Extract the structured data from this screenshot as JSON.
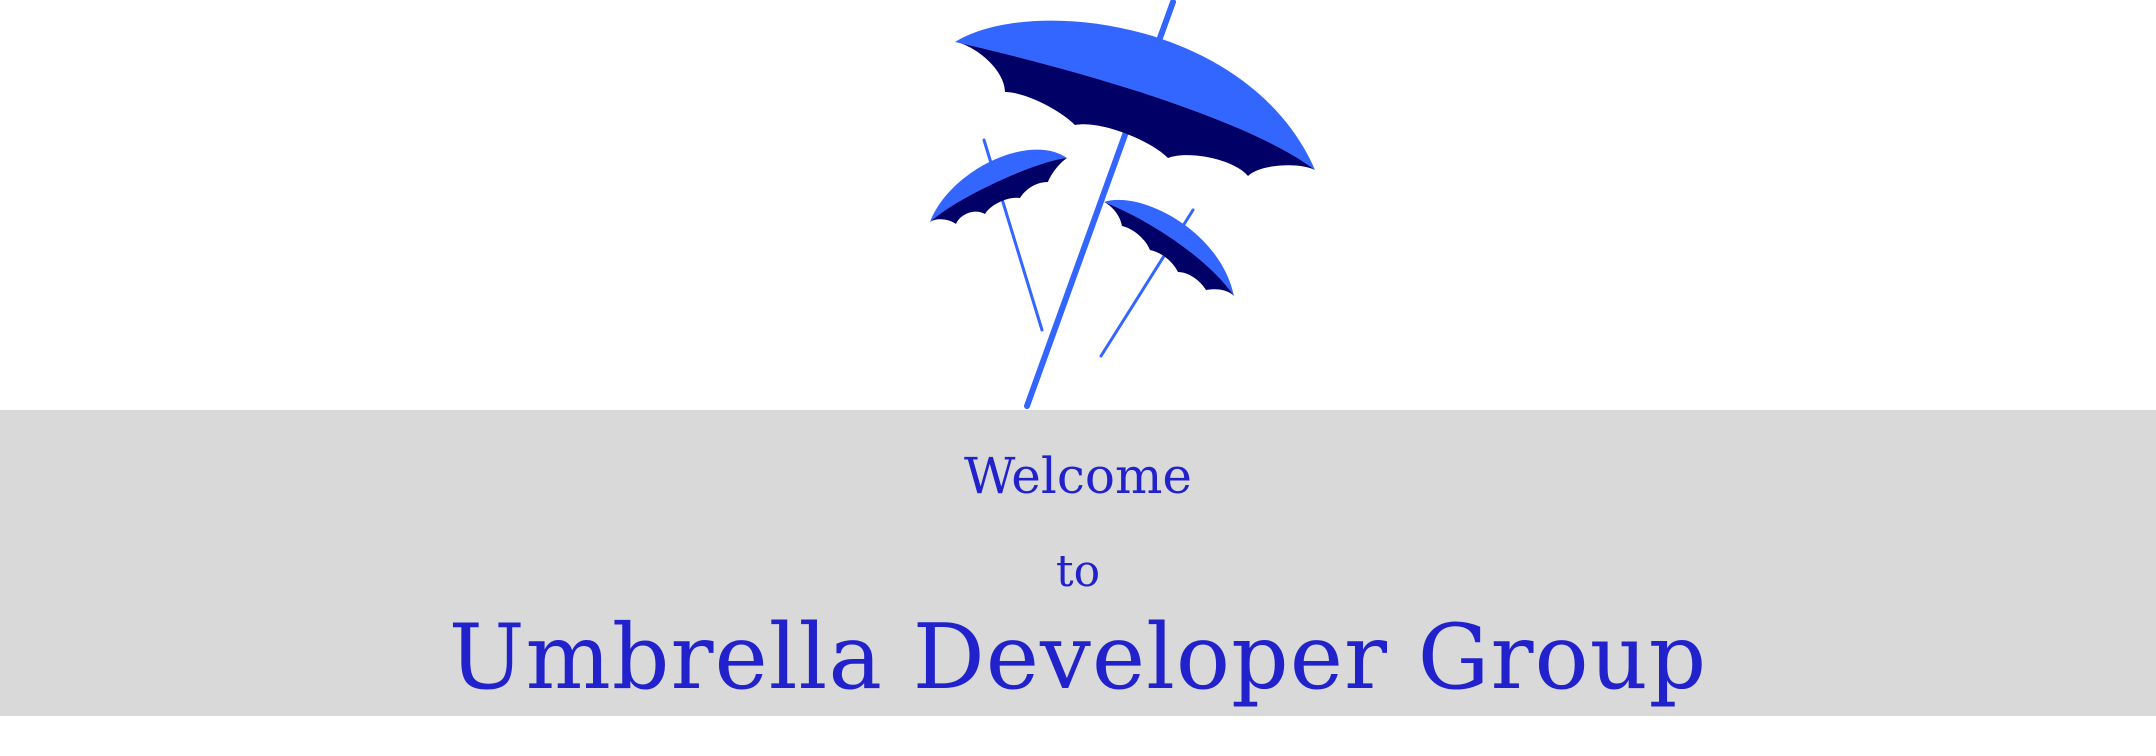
{
  "logo": {
    "icon": "umbrellas-logo-icon",
    "colors": {
      "canopy_light": "#3366ff",
      "canopy_dark": "#000066",
      "shaft": "#3366ff"
    }
  },
  "welcome": {
    "line1": "Welcome",
    "line2": "to",
    "group_name": "Umbrella Developer Group"
  },
  "colors": {
    "text": "#2222cc",
    "band_background": "#d9d9d9",
    "page_background": "#ffffff"
  }
}
